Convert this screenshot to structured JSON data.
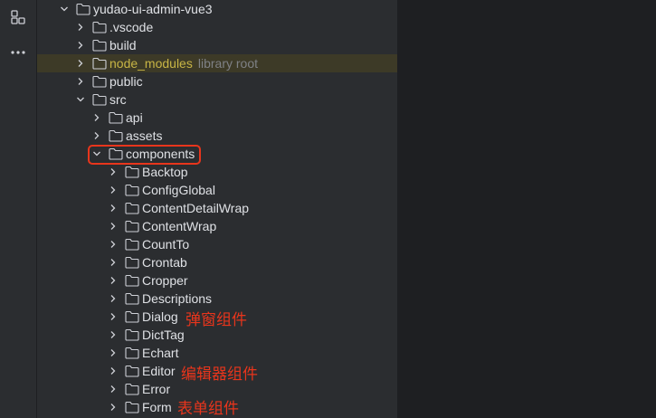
{
  "activity_bar": {
    "icons": [
      "structure-icon",
      "more-icon"
    ]
  },
  "tree": {
    "rows": [
      {
        "label": "yudao-ui-admin-vue3",
        "expanded": true
      },
      {
        "label": ".vscode",
        "expanded": false
      },
      {
        "label": "build",
        "expanded": false
      },
      {
        "label": "node_modules",
        "suffix": "library root",
        "expanded": false
      },
      {
        "label": "public",
        "expanded": false
      },
      {
        "label": "src",
        "expanded": true
      },
      {
        "label": "api",
        "expanded": false
      },
      {
        "label": "assets",
        "expanded": false
      },
      {
        "label": "components",
        "expanded": true
      },
      {
        "label": "Backtop",
        "expanded": false
      },
      {
        "label": "ConfigGlobal",
        "expanded": false
      },
      {
        "label": "ContentDetailWrap",
        "expanded": false
      },
      {
        "label": "ContentWrap",
        "expanded": false
      },
      {
        "label": "CountTo",
        "expanded": false
      },
      {
        "label": "Crontab",
        "expanded": false
      },
      {
        "label": "Cropper",
        "expanded": false
      },
      {
        "label": "Descriptions",
        "expanded": false
      },
      {
        "label": "Dialog",
        "expanded": false
      },
      {
        "label": "DictTag",
        "expanded": false
      },
      {
        "label": "Echart",
        "expanded": false
      },
      {
        "label": "Editor",
        "expanded": false
      },
      {
        "label": "Error",
        "expanded": false
      },
      {
        "label": "Form",
        "expanded": false
      }
    ]
  },
  "annotations": {
    "dialog": "弹窗组件",
    "editor": "编辑器组件",
    "form": "表单组件"
  },
  "colors": {
    "annotation": "#e8351c",
    "library_root_highlight": "#3d3a27",
    "node_modules_text": "#c8b545"
  }
}
